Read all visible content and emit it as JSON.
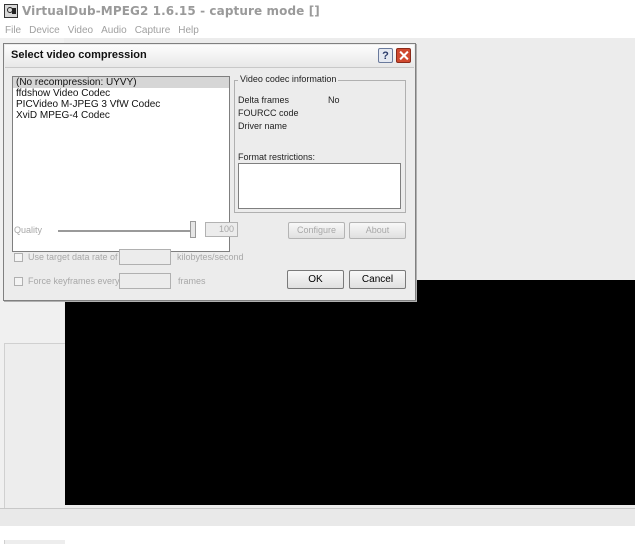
{
  "app": {
    "title": "VirtualDub-MPEG2 1.6.15 - capture mode []",
    "menu": [
      "File",
      "Device",
      "Video",
      "Audio",
      "Capture",
      "Help"
    ]
  },
  "dialog": {
    "title": "Select video compression",
    "codecs": [
      "(No recompression: UYVY)",
      "ffdshow Video Codec",
      "PICVideo M-JPEG 3 VfW Codec",
      "XviD MPEG-4 Codec"
    ],
    "selected_codec": "(No recompression: UYVY)",
    "info": {
      "legend": "Video codec information",
      "delta_frames_label": "Delta frames",
      "delta_frames_value": "No",
      "fourcc_label": "FOURCC code",
      "driver_label": "Driver name",
      "restrictions_label": "Format restrictions:"
    },
    "quality_label": "Quality",
    "quality_value": "100",
    "configure_label": "Configure",
    "about_label": "About",
    "target_rate_label": "Use target data rate of",
    "target_rate_unit": "kilobytes/second",
    "keyframes_label": "Force keyframes every",
    "keyframes_unit": "frames",
    "ok_label": "OK",
    "cancel_label": "Cancel"
  }
}
